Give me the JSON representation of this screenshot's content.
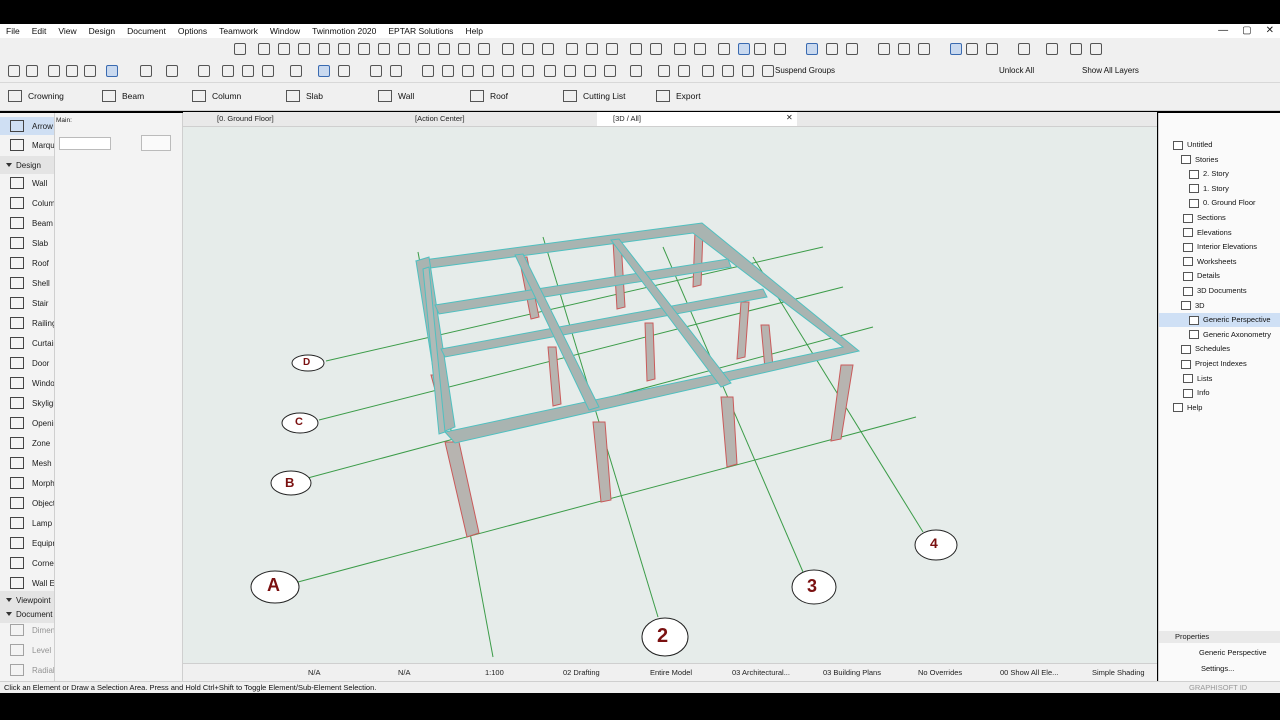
{
  "menu": [
    "File",
    "Edit",
    "View",
    "Design",
    "Document",
    "Options",
    "Teamwork",
    "Window",
    "Twinmotion 2020",
    "EPTAR Solutions",
    "Help"
  ],
  "window_controls": {
    "minimize": "—",
    "maximize": "▢",
    "close": "✕"
  },
  "toolbar2": {
    "suspend_groups": "Suspend Groups",
    "unlock_all": "Unlock All",
    "show_all_layers": "Show All Layers"
  },
  "toolbar3": {
    "crowning": "Crowning",
    "beam": "Beam",
    "column": "Column",
    "slab": "Slab",
    "wall": "Wall",
    "roof": "Roof",
    "cutting_list": "Cutting List",
    "export": "Export"
  },
  "toolbox": {
    "arrow": "Arrow",
    "marquee": "Marquee",
    "design_header": "Design",
    "tools": [
      "Wall",
      "Column",
      "Beam",
      "Slab",
      "Roof",
      "Shell",
      "Stair",
      "Railing",
      "Curtain Wall",
      "Door",
      "Window",
      "Skylight",
      "Opening",
      "Zone",
      "Mesh",
      "Morph",
      "Object",
      "Lamp",
      "Equipment",
      "Corner Window",
      "Wall End"
    ],
    "viewpoint_header": "Viewpoint",
    "document_header": "Document",
    "doc_tools": [
      "Dimension",
      "Level",
      "Radial"
    ]
  },
  "infobox": {
    "main_label": "Main:"
  },
  "tabs": [
    "[0. Ground Floor]",
    "[Action Center]",
    "[3D / All]"
  ],
  "grid_labels": {
    "letters": [
      "A",
      "B",
      "C",
      "D"
    ],
    "numbers": [
      "2",
      "3",
      "4"
    ]
  },
  "view_status": {
    "na1": "N/A",
    "na2": "N/A",
    "scale": "1:100",
    "pen_set": "02 Drafting",
    "model": "Entire Model",
    "structure": "03 Architectural...",
    "layers": "03 Building Plans",
    "overrides": "No Overrides",
    "dim": "00 Show All Ele...",
    "shading": "Simple Shading"
  },
  "status_message": "Click an Element or Draw a Selection Area. Press and Hold Ctrl+Shift to Toggle Element/Sub-Element Selection.",
  "navigator": {
    "untitled": "Untitled",
    "stories": "Stories",
    "story2": "2. Story",
    "story1": "1. Story",
    "story0": "0. Ground Floor",
    "sections": "Sections",
    "elevations": "Elevations",
    "interior_elevations": "Interior Elevations",
    "worksheets": "Worksheets",
    "details": "Details",
    "documents3d": "3D Documents",
    "three_d": "3D",
    "generic_perspective": "Generic Perspective",
    "generic_axonometry": "Generic Axonometry",
    "schedules": "Schedules",
    "project_indexes": "Project Indexes",
    "lists": "Lists",
    "info": "Info",
    "help": "Help"
  },
  "properties": {
    "header": "Properties",
    "value": "Generic Perspective",
    "settings": "Settings..."
  },
  "brand": "GRAPHISOFT ID"
}
